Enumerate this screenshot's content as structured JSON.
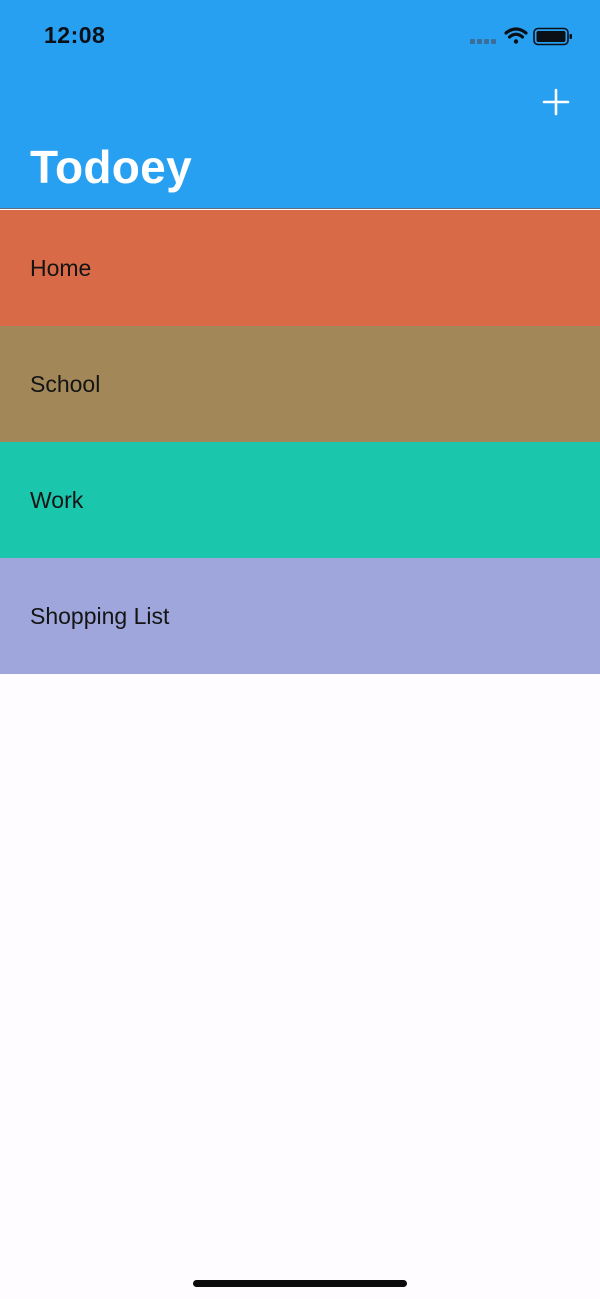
{
  "colors": {
    "nav_bar": "#28a0f2",
    "page_background": "#fefcfe",
    "title_text": "#ffffff",
    "row_text": "#141414"
  },
  "status_bar": {
    "time": "12:08",
    "icons": [
      "cellular-signal-icon",
      "wifi-icon",
      "battery-icon"
    ]
  },
  "nav_bar": {
    "title": "Todoey",
    "add_icon": "plus-icon"
  },
  "categories": [
    {
      "name": "Home",
      "color": "#d96a48"
    },
    {
      "name": "School",
      "color": "#a28858"
    },
    {
      "name": "Work",
      "color": "#1ac6ac"
    },
    {
      "name": "Shopping List",
      "color": "#9ea6db"
    }
  ]
}
